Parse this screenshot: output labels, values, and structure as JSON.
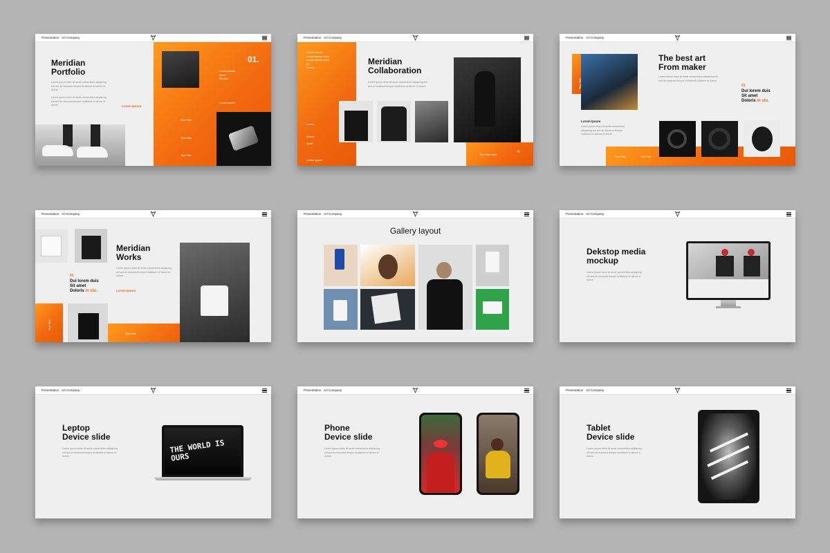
{
  "topbar": {
    "left_label": "Presentation",
    "right_label": "Art Company",
    "logo_icon": "deer-head-icon",
    "menu_icon": "hamburger-menu-icon"
  },
  "lorem_short": "Lorem ipsum dolor sit amet consectetur adipiscing elit sed do eiusmod tempor incididunt ut labore et dolore",
  "slides": {
    "portfolio": {
      "title": "Meridian\nPortfolio",
      "number": "01.",
      "link": "Lorem Ipsum",
      "orange_text": "Lorem ipsum\ndolor\nSit plus",
      "small_lorem": "Lorem ipsum",
      "text_title_1": "Text Title",
      "text_title_2": "Text Title",
      "text_title_3": "Text Title"
    },
    "collaboration": {
      "title": "Meridian\nCollaboration",
      "list": "Lorem Ipsum\nLorem ipsum dolor\nLorem ipsum dolor\nsit\nLorem",
      "side_1": "Lorem",
      "side_2": "Dolors",
      "side_3": "Amet",
      "bottom_label": "Lorem Ipsum",
      "cta": "Text Title Here",
      "plus": "+"
    },
    "best_art": {
      "title": "The best art\nFrom maker",
      "number": "01",
      "bullet": "Dui lorem duis\nSit amet\nDoloris",
      "bullet_highlight": "in ciu.",
      "sub_label": "Lorem Ipsum",
      "vertical_label": "Text Title",
      "tab_1": "Text Title",
      "tab_2": "Text Title"
    },
    "works": {
      "title": "Meridian\nWorks",
      "number": "01",
      "bullet": "Dui lorem duis\nSit amet\nDoloris",
      "bullet_highlight": "in ciu.",
      "link": "Lorem Ipsum",
      "vertical_label": "Text Title",
      "bar_label": "Text Title"
    },
    "gallery": {
      "title": "Gallery layout"
    },
    "desktop": {
      "title": "Dekstop media\nmockup"
    },
    "laptop": {
      "title": "Leptop\nDevice slide",
      "screen_text": "THE WORLD IS OURS"
    },
    "phone": {
      "title": "Phone\nDevice slide"
    },
    "tablet": {
      "title": "Tablet\nDevice slide"
    }
  },
  "colors": {
    "accent": "#f26a0f",
    "accent_light": "#ff9a1c",
    "slide_bg": "#efefef",
    "page_bg": "#b4b4b4"
  }
}
